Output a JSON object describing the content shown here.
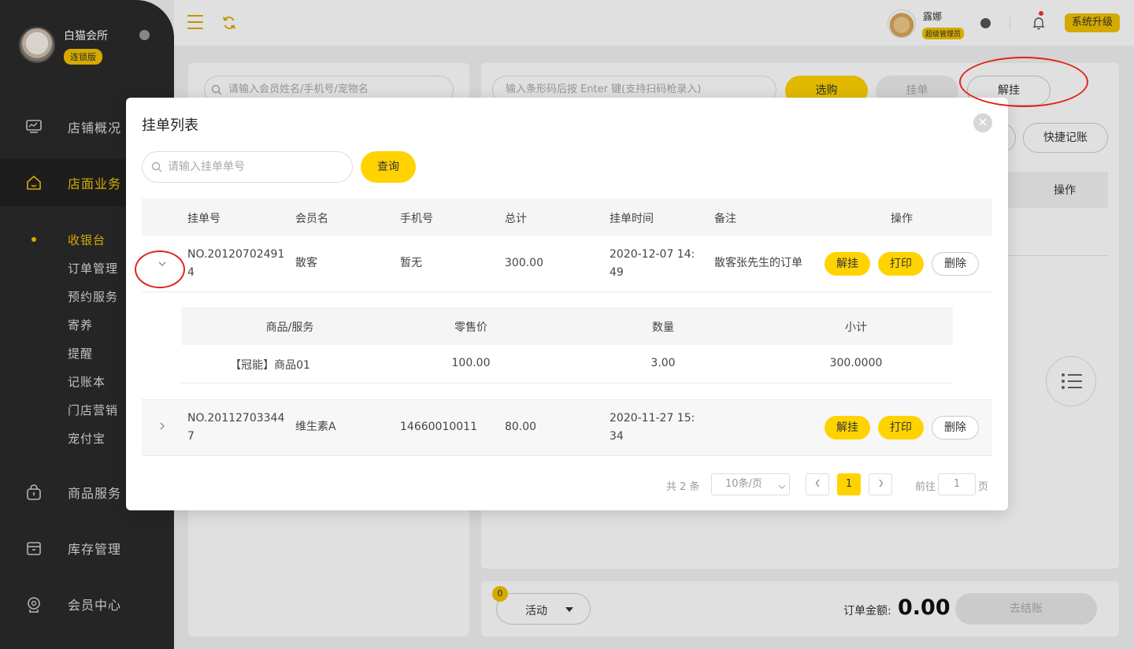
{
  "sidebar": {
    "store_name": "白猫会所",
    "store_badge": "连锁版",
    "nav": [
      {
        "label": "店铺概况",
        "icon": "monitor-icon"
      },
      {
        "label": "店面业务",
        "icon": "home-icon",
        "active": true
      },
      {
        "label": "商品服务",
        "icon": "bag-icon"
      },
      {
        "label": "库存管理",
        "icon": "box-icon"
      },
      {
        "label": "会员中心",
        "icon": "member-icon"
      }
    ],
    "sub_items": [
      "收银台",
      "订单管理",
      "预约服务",
      "寄养",
      "提醒",
      "记账本",
      "门店营销",
      "宠付宝"
    ]
  },
  "topbar": {
    "user_name": "露娜",
    "user_role": "超级管理员",
    "upgrade_label": "系统升级"
  },
  "background": {
    "member_search_placeholder": "请输入会员姓名/手机号/宠物名",
    "scan_placeholder": "输入条形码后按 Enter 键(支持扫码枪录入)",
    "select_label": "选购",
    "hold_label": "挂单",
    "unhold_label": "解挂",
    "quick_account_label": "快捷记账",
    "operation_header": "操作",
    "activity_label": "活动",
    "activity_count": "0",
    "order_amount_label": "订单金额:",
    "order_amount": "0.00",
    "checkout_label": "去结账"
  },
  "modal": {
    "title": "挂单列表",
    "search_placeholder": "请输入挂单单号",
    "query_label": "查询",
    "columns": [
      "挂单号",
      "会员名",
      "手机号",
      "总计",
      "挂单时间",
      "备注",
      "操作"
    ],
    "rows": [
      {
        "order_no_line1": "NO.20120702491",
        "order_no_line2": "4",
        "member": "散客",
        "phone": "暂无",
        "total": "300.00",
        "time_line1": "2020-12-07 14:",
        "time_line2": "49",
        "note": "散客张先生的订单",
        "expanded": true
      },
      {
        "order_no_line1": "NO.20112703344",
        "order_no_line2": "7",
        "member": "维生素A",
        "phone": "14660010011",
        "total": "80.00",
        "time_line1": "2020-11-27 15:",
        "time_line2": "34",
        "note": "",
        "expanded": false
      }
    ],
    "actions": {
      "unhold": "解挂",
      "print": "打印",
      "delete": "删除"
    },
    "detail_columns": [
      "商品/服务",
      "零售价",
      "数量",
      "小计"
    ],
    "detail_rows": [
      {
        "item": "【冠能】商品01",
        "price": "100.00",
        "qty": "3.00",
        "subtotal": "300.0000"
      }
    ],
    "pagination": {
      "total_text": "共 2 条",
      "page_size": "10条/页",
      "current_page": "1",
      "goto_label": "前往",
      "goto_value": "1",
      "page_suffix": "页"
    }
  },
  "colors": {
    "accent": "#ffd300",
    "sidebar": "#2b2b2b",
    "annotation": "#e0251b"
  }
}
